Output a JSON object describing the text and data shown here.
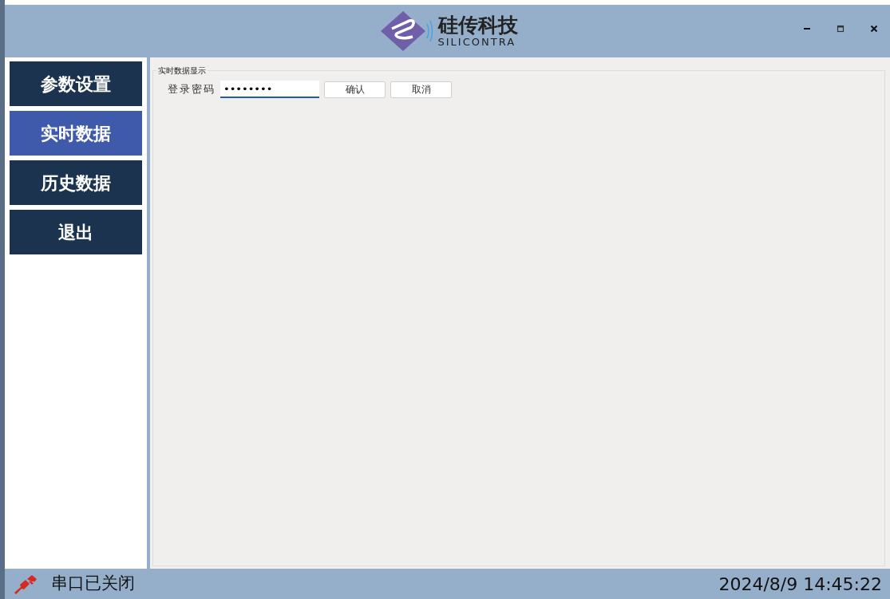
{
  "header": {
    "brand_name": "硅传科技",
    "brand_subtitle": "SILICONTRA",
    "controls": [
      {
        "kind": "minimize"
      },
      {
        "kind": "maximize"
      },
      {
        "kind": "close"
      }
    ]
  },
  "sidebar": {
    "items": [
      {
        "label": "参数设置",
        "selected": false
      },
      {
        "label": "实时数据",
        "selected": true
      },
      {
        "label": "历史数据",
        "selected": false
      },
      {
        "label": "退出",
        "selected": false
      }
    ]
  },
  "panel": {
    "title": "实时数据显示",
    "password_label": "登录密码",
    "password_value": "••••••••",
    "buttons": [
      "确认",
      "取消"
    ]
  },
  "status_bar": {
    "serial_status": "串口已关闭",
    "datetime": "2024/8/9 14:45:22"
  }
}
